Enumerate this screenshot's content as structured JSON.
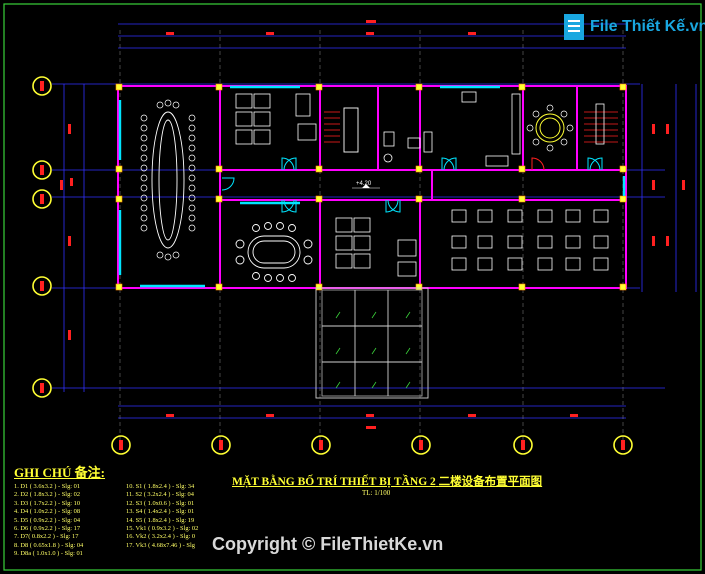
{
  "drawing": {
    "title": "MẶT BẰNG BỐ TRÍ THIẾT BỊ TẦNG 2",
    "title_cn": "二楼设备布置平面图",
    "scale": "TL: 1/100",
    "level_mark": "+4.20"
  },
  "legend": {
    "title": "GHI CHÚ 备注:",
    "col1": [
      "1. D1 ( 3.6x3.2 ) - Slg: 01",
      "2. D2 ( 1.8x3.2 ) - Slg: 02",
      "3. D3 ( 1.7x2.2 ) - Slg: 10",
      "4. D4 ( 1.0x2.2 ) - Slg: 08",
      "5. D5 ( 0.9x2.2 ) - Slg: 04",
      "6. D6 ( 0.9x2.2 ) - Slg: 17",
      "7. D7( 0.8x2.2 ) - Slg: 17",
      "8. D8 ( 0.65x1.8 ) - Slg: 04",
      "9. D8a ( 1.0x1.0 ) - Slg: 01"
    ],
    "col2": [
      "10. S1 ( 1.8x2.4 ) - Slg: 34",
      "11. S2 ( 3.2x2.4 ) - Slg: 04",
      "12. S3 ( 1.0x0.6 ) - Slg: 01",
      "13. S4 ( 1.4x2.4 ) - Slg: 01",
      "14. S5 ( 1.8x2.4 ) - Slg: 19",
      "15. Vk1 ( 0.9x3.2 ) - Slg: 02",
      "16. Vk2 ( 3.2x2.4 ) - Slg: 0",
      "17. Vk3 ( 4.68x7.46 ) - Slg"
    ]
  },
  "brand": {
    "logo_text": "File Thiết Kế.vn",
    "copyright": "Copyright © FileThietKe.vn"
  },
  "colors": {
    "background": "#000000",
    "wall": "#ff00ff",
    "dimension": "#2a2aff",
    "furniture": "#ffffff",
    "window": "#00e5ff",
    "annotation": "#ffff33",
    "red_label": "#ff2020"
  }
}
